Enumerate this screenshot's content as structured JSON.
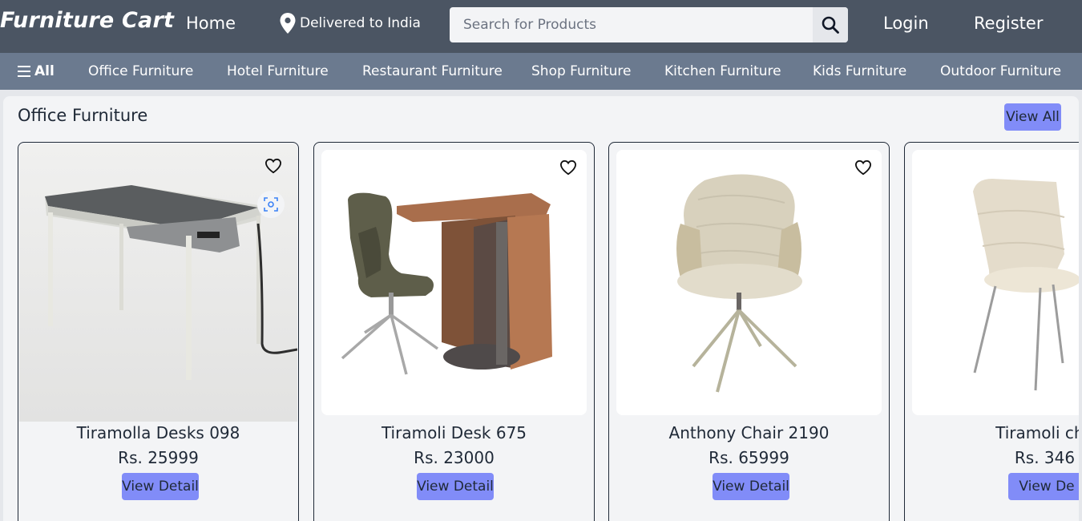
{
  "header": {
    "logo": "Furniture Cart",
    "home": "Home",
    "delivery": "Delivered to India",
    "search_placeholder": "Search for Products",
    "login": "Login",
    "register": "Register"
  },
  "categories": {
    "all": "All",
    "items": [
      "Office Furniture",
      "Hotel Furniture",
      "Restaurant Furniture",
      "Shop Furniture",
      "Kitchen Furniture",
      "Kids Furniture",
      "Outdoor Furniture"
    ]
  },
  "section": {
    "title": "Office Furniture",
    "view_all": "View All"
  },
  "products": [
    {
      "name": "Tiramolla Desks 098",
      "price": "Rs. 25999",
      "button": "View Detail"
    },
    {
      "name": "Tiramoli Desk 675",
      "price": "Rs. 23000",
      "button": "View Detail"
    },
    {
      "name": "Anthony Chair 2190",
      "price": "Rs. 65999",
      "button": "View Detail"
    },
    {
      "name": "Tiramoli cha",
      "price": "Rs. 346",
      "button": "View De"
    }
  ],
  "colors": {
    "header_bg": "#4b5563",
    "category_bg": "#6b7a8f",
    "accent_button": "#818cf8",
    "page_bg": "#e5e7eb"
  },
  "icons": [
    "map-pin-icon",
    "search-icon",
    "menu-icon",
    "heart-icon",
    "visual-search-icon"
  ]
}
